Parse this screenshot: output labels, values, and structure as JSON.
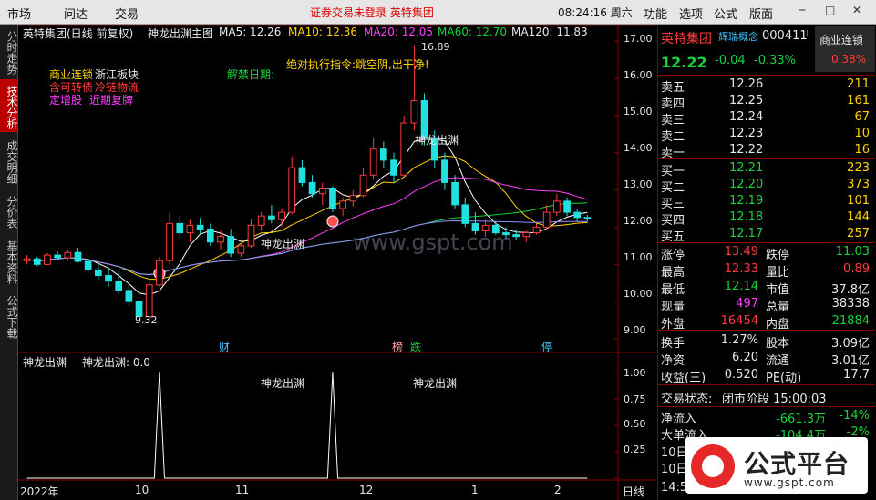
{
  "topbar": {
    "menu": [
      "市场",
      "问达",
      "交易"
    ],
    "notice": "证券交易未登录  英特集团",
    "clock": "08:24:16 周六",
    "right_menu": [
      "功能",
      "选项",
      "公式",
      "版面"
    ]
  },
  "left_tabs": [
    "分时走势",
    "技术分析",
    "成交明细",
    "分价表",
    "基本资料",
    "公式下载"
  ],
  "chart": {
    "header": {
      "title": "英特集团(日线 前复权)",
      "indicator": "神龙出渊主图",
      "ma5": "MA5: 12.26",
      "ma10": "MA10: 12.36",
      "ma20": "MA20: 12.05",
      "ma60": "MA60: 12.70",
      "ma120": "MA120: 11.83"
    },
    "annotations": {
      "concept1": "商业连锁",
      "concept1b": "浙江板块",
      "concept2": "含可转债",
      "concept2b": "冷链物流",
      "concept3": "定增股",
      "concept3b": "近期复牌",
      "ban": "解禁日期:",
      "order": "绝对执行指令:跳空阴,出干净!",
      "high": "16.89",
      "low": "9.32",
      "signal1": "神龙出渊",
      "signal2": "神龙出渊",
      "watermark": "www.gspt.com"
    },
    "price_ticks": [
      "17.00",
      "16.00",
      "15.00",
      "14.00",
      "13.00",
      "12.00",
      "11.00",
      "10.00",
      "9.00"
    ],
    "event_marks": [
      "财",
      "榜",
      "跌",
      "停"
    ],
    "sub": {
      "title": "神龙出渊",
      "value": "神龙出渊: 0.0",
      "ticks": [
        "1.00",
        "0.75",
        "0.50",
        "0.25"
      ],
      "signal_a": "神龙出渊",
      "signal_b": "神龙出渊"
    },
    "x_labels": [
      "2022年",
      "10",
      "11",
      "12",
      "1",
      "2"
    ],
    "period": "日线"
  },
  "quote": {
    "name": "英特集团",
    "tag": "辉瑞概念",
    "code": "000411",
    "badge": "L",
    "sector": "商业连锁",
    "sector_pct": "0.38%",
    "price": "12.22",
    "change": "-0.04",
    "change_pct": "-0.33%",
    "asks": [
      {
        "label": "卖五",
        "price": "12.26",
        "vol": "211"
      },
      {
        "label": "卖四",
        "price": "12.25",
        "vol": "161"
      },
      {
        "label": "卖三",
        "price": "12.24",
        "vol": "67"
      },
      {
        "label": "卖二",
        "price": "12.23",
        "vol": "10"
      },
      {
        "label": "卖一",
        "price": "12.22",
        "vol": "16"
      }
    ],
    "bids": [
      {
        "label": "买一",
        "price": "12.21",
        "vol": "223"
      },
      {
        "label": "买二",
        "price": "12.20",
        "vol": "373"
      },
      {
        "label": "买三",
        "price": "12.19",
        "vol": "101"
      },
      {
        "label": "买四",
        "price": "12.18",
        "vol": "144"
      },
      {
        "label": "买五",
        "price": "12.17",
        "vol": "257"
      }
    ],
    "stats": [
      {
        "l1": "涨停",
        "v1": "13.49",
        "l2": "跌停",
        "v2": "11.03"
      },
      {
        "l1": "最高",
        "v1": "12.33",
        "l2": "量比",
        "v2": "0.89"
      },
      {
        "l1": "最低",
        "v1": "12.14",
        "l2": "市值",
        "v2": "37.8亿"
      },
      {
        "l1": "现量",
        "v1": "497",
        "l2": "总量",
        "v2": "38338"
      },
      {
        "l1": "外盘",
        "v1": "16454",
        "l2": "内盘",
        "v2": "21884"
      }
    ],
    "stats2": [
      {
        "l1": "换手",
        "v1": "1.27%",
        "l2": "股本",
        "v2": "3.09亿"
      },
      {
        "l1": "净资",
        "v1": "6.20",
        "l2": "流通",
        "v2": "3.01亿"
      },
      {
        "l1": "收益(三)",
        "v1": "0.520",
        "l2": "PE(动)",
        "v2": "17.7"
      }
    ],
    "status_label": "交易状态:",
    "status_value": "闭市阶段 15:00:03",
    "flow": [
      {
        "label": "净流入",
        "value": "-661.3万",
        "pct": "-14%"
      },
      {
        "label": "大单流入",
        "value": "-104.4万",
        "pct": "-2%"
      }
    ],
    "bottom_rows": [
      "10日",
      "10日",
      "14:5"
    ]
  },
  "brand": {
    "title": "公式平台",
    "url": "www.gspt.com"
  },
  "colors": {
    "bg": "#000000",
    "up": "#ff3b3b",
    "down": "#18d23c",
    "ma5": "#ffffff",
    "ma10": "#ffd400",
    "ma20": "#ff40ff",
    "ma60": "#18d23c",
    "ma120": "#9090ff"
  },
  "chart_data": {
    "type": "candlestick",
    "ylim": [
      9.0,
      17.2
    ],
    "candles": [
      [
        11.1,
        11.25,
        11.0,
        11.15
      ],
      [
        11.15,
        11.2,
        10.95,
        11.0
      ],
      [
        11.0,
        11.3,
        10.98,
        11.25
      ],
      [
        11.25,
        11.35,
        11.1,
        11.18
      ],
      [
        11.18,
        11.4,
        11.1,
        11.32
      ],
      [
        11.32,
        11.45,
        11.05,
        11.08
      ],
      [
        11.08,
        11.15,
        10.8,
        10.85
      ],
      [
        10.85,
        11.0,
        10.6,
        10.7
      ],
      [
        10.7,
        10.9,
        10.4,
        10.55
      ],
      [
        10.55,
        10.8,
        10.2,
        10.3
      ],
      [
        10.3,
        10.5,
        9.9,
        10.0
      ],
      [
        10.0,
        10.2,
        9.32,
        9.6
      ],
      [
        9.6,
        10.6,
        9.55,
        10.45
      ],
      [
        10.45,
        11.2,
        10.4,
        11.1
      ],
      [
        11.1,
        12.4,
        11.0,
        12.1
      ],
      [
        12.1,
        12.3,
        11.7,
        11.85
      ],
      [
        11.85,
        12.2,
        11.6,
        12.05
      ],
      [
        12.05,
        12.25,
        11.8,
        11.95
      ],
      [
        11.95,
        12.1,
        11.5,
        11.6
      ],
      [
        11.6,
        11.9,
        11.4,
        11.75
      ],
      [
        11.75,
        11.95,
        11.2,
        11.3
      ],
      [
        11.3,
        11.6,
        11.2,
        11.5
      ],
      [
        11.5,
        12.2,
        11.45,
        12.05
      ],
      [
        12.05,
        12.4,
        11.9,
        12.3
      ],
      [
        12.3,
        12.6,
        12.1,
        12.2
      ],
      [
        12.2,
        12.5,
        12.0,
        12.4
      ],
      [
        12.4,
        13.9,
        12.35,
        13.6
      ],
      [
        13.6,
        13.8,
        13.1,
        13.2
      ],
      [
        13.2,
        13.4,
        12.8,
        12.9
      ],
      [
        12.9,
        13.2,
        12.6,
        13.05
      ],
      [
        13.05,
        13.1,
        12.4,
        12.5
      ],
      [
        12.5,
        12.8,
        12.3,
        12.7
      ],
      [
        12.7,
        13.0,
        12.55,
        12.85
      ],
      [
        12.85,
        13.6,
        12.8,
        13.4
      ],
      [
        13.4,
        14.4,
        13.3,
        14.1
      ],
      [
        14.1,
        14.3,
        13.6,
        13.8
      ],
      [
        13.8,
        14.0,
        13.2,
        13.4
      ],
      [
        13.4,
        15.0,
        13.35,
        14.8
      ],
      [
        14.8,
        16.89,
        14.6,
        15.4
      ],
      [
        15.4,
        15.6,
        14.2,
        14.4
      ],
      [
        14.4,
        14.6,
        13.6,
        13.8
      ],
      [
        13.8,
        14.0,
        13.0,
        13.2
      ],
      [
        13.2,
        13.4,
        12.5,
        12.6
      ],
      [
        12.6,
        12.8,
        12.0,
        12.1
      ],
      [
        12.1,
        12.4,
        11.8,
        11.9
      ],
      [
        11.9,
        12.2,
        11.75,
        12.05
      ],
      [
        12.05,
        12.15,
        11.8,
        11.85
      ],
      [
        11.85,
        12.0,
        11.7,
        11.8
      ],
      [
        11.8,
        11.95,
        11.65,
        11.75
      ],
      [
        11.75,
        11.9,
        11.6,
        11.85
      ],
      [
        11.85,
        12.1,
        11.8,
        12.0
      ],
      [
        12.0,
        12.6,
        11.95,
        12.4
      ],
      [
        12.4,
        12.9,
        12.3,
        12.7
      ],
      [
        12.7,
        12.8,
        12.3,
        12.4
      ],
      [
        12.4,
        12.5,
        12.15,
        12.26
      ],
      [
        12.26,
        12.33,
        12.14,
        12.22
      ]
    ],
    "signals": [
      0.23,
      0.53
    ]
  }
}
